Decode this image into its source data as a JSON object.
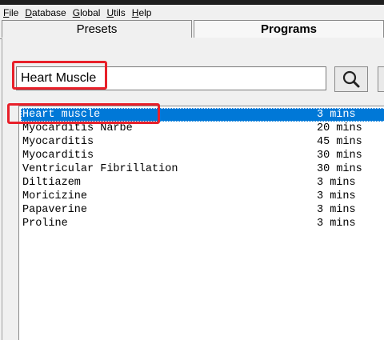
{
  "menu": [
    "File",
    "Database",
    "Global",
    "Utils",
    "Help"
  ],
  "menu_accel": [
    "F",
    "D",
    "G",
    "U",
    "H"
  ],
  "tabs": {
    "presets": "Presets",
    "programs": "Programs"
  },
  "search": {
    "value": "Heart Muscle"
  },
  "icons": {
    "search_button": "magnifier-icon"
  },
  "programs": [
    {
      "name": "Heart muscle",
      "duration": "3 mins",
      "selected": true
    },
    {
      "name": "Myocarditis Narbe",
      "duration": "20 mins"
    },
    {
      "name": "Myocarditis",
      "duration": "45 mins"
    },
    {
      "name": "Myocarditis",
      "duration": "30 mins"
    },
    {
      "name": "Ventricular Fibrillation",
      "duration": "30 mins"
    },
    {
      "name": "Diltiazem",
      "duration": "3 mins"
    },
    {
      "name": "Moricizine",
      "duration": "3 mins"
    },
    {
      "name": "Papaverine",
      "duration": "3 mins"
    },
    {
      "name": "Proline",
      "duration": "3 mins"
    }
  ],
  "colors": {
    "selection": "#0078d7",
    "highlight": "#e8202a"
  }
}
